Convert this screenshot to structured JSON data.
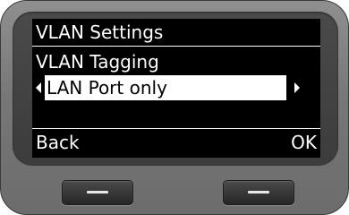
{
  "screen": {
    "title": "VLAN Settings",
    "field_label": "VLAN Tagging",
    "selected_option": "LAN Port only"
  },
  "softkeys": {
    "left_label": "Back",
    "right_label": "OK"
  },
  "icons": {
    "prev_option": "triangle-left-icon",
    "next_option": "triangle-right-icon",
    "softkey_mark": "dash-icon"
  },
  "colors": {
    "screen_background": "#000000",
    "screen_text": "#ffffff",
    "selection_background": "#ffffff",
    "selection_text": "#000000",
    "device_body": "#7a7a7a"
  }
}
